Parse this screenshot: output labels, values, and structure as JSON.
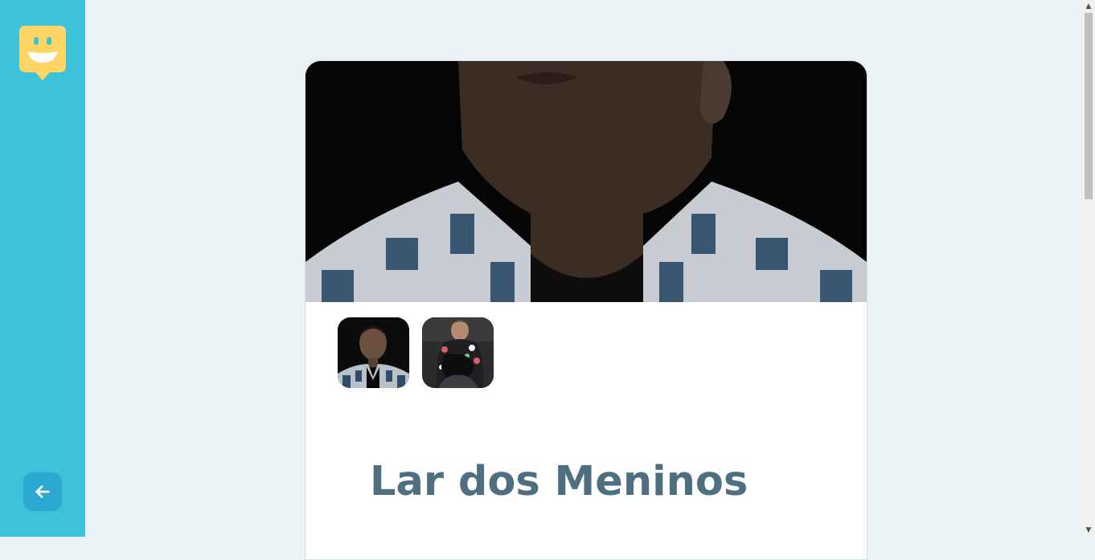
{
  "app": {
    "logo_icon": "smiling-face-speech-bubble-icon",
    "accent_color": "#3cc3d9",
    "logo_color": "#ffd666"
  },
  "sidebar": {
    "back_icon": "arrow-left-icon",
    "back_button_color": "#2da8d2"
  },
  "orphanage": {
    "name": "Lar dos Meninos",
    "images": [
      {
        "alt": "man in plaid shirt, close-up of chin and neck",
        "active": true
      },
      {
        "alt": "man in plaid shirt, portrait"
      },
      {
        "alt": "man in floral shirt holding a black dog"
      }
    ]
  },
  "title_color": "#4d6f80"
}
